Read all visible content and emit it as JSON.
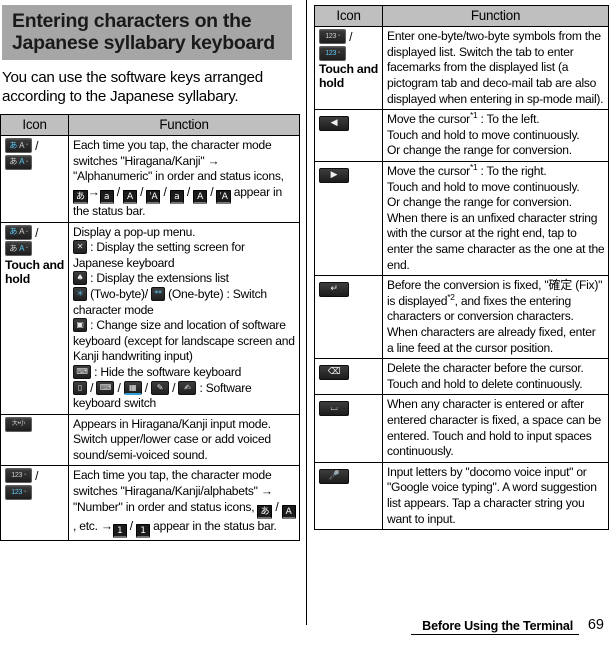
{
  "page": {
    "title": "Entering characters on the Japanese syllabary keyboard",
    "intro": "You can use the software keys arranged according to the Japanese syllabary.",
    "footer_section": "Before Using the Terminal",
    "footer_page_number": "69"
  },
  "table": {
    "headers": {
      "icon": "Icon",
      "function": "Function"
    }
  },
  "left_rows": [
    {
      "icon_name": "kana-alphanumeric-switch-key",
      "icon_glyphs": [
        "あ",
        "A"
      ],
      "separator": "/",
      "touch_and_hold": "",
      "text_1": "Each time you tap, the character mode switches \"Hiragana/Kanji\" → \"Alphanumeric\" in order and status icons,",
      "status_icons": [
        "あ",
        "a",
        "A",
        "A",
        "a",
        "A",
        "A"
      ],
      "arrow": "→",
      "text_2": "appear in the status bar."
    },
    {
      "icon_name": "kana-alphanumeric-switch-key-hold",
      "icon_glyphs": [
        "あ",
        "A"
      ],
      "separator": "/",
      "touch_and_hold": "Touch and hold",
      "line_intro": "Display a pop-up menu.",
      "items": [
        {
          "icon": "settings-wrench-icon",
          "text": ": Display the setting screen for Japanese keyboard"
        },
        {
          "icon": "extensions-icon",
          "text": ": Display the extensions list"
        },
        {
          "icon": "two-byte-icon",
          "text": "(Two-byte)/",
          "icon2": "one-byte-icon",
          "text2": "(One-byte) : Switch character mode"
        },
        {
          "icon": "keyboard-size-location-icon",
          "text": ": Change size and location of software keyboard (except for landscape screen and Kanji handwriting input)"
        },
        {
          "icon": "hide-keyboard-icon",
          "text": ": Hide the software keyboard"
        },
        {
          "icon": "kb-switch-10key-icon",
          "text": ": Software keyboard switch",
          "icons_row": [
            "kb-switch-10key-icon",
            "kb-switch-qwerty-icon",
            "kb-switch-grid-icon",
            "kb-switch-handwriting-icon",
            "kb-switch-handwriting2-icon"
          ]
        }
      ]
    },
    {
      "icon_name": "case-voiced-sound-key",
      "icon_glyph": "大•小",
      "text": "Appears in Hiragana/Kanji input mode. Switch upper/lower case or add voiced sound/semi-voiced sound."
    },
    {
      "icon_name": "number-mode-switch-key",
      "icon_glyphs": [
        "123",
        "123"
      ],
      "separator": "/",
      "text_1": "Each time you tap, the character mode switches \"Hiragana/Kanji/alphabets\" → \"Number\" in order and status icons,",
      "status_icons_a": [
        "あ",
        "A"
      ],
      "mid_text": ", etc.",
      "arrow": "→",
      "status_icons_b": [
        "1",
        "1"
      ],
      "text_2": "appear in the status bar."
    }
  ],
  "right_rows": [
    {
      "icon_name": "number-mode-switch-key-hold",
      "icon_glyphs": [
        "123",
        "123"
      ],
      "separator": "/",
      "touch_and_hold": "Touch and hold",
      "text": "Enter one-byte/two-byte symbols from the displayed list. Switch the tab to enter facemarks from the displayed list (a pictogram tab and deco-mail tab are also displayed when entering in sp-mode mail)."
    },
    {
      "icon_name": "cursor-left-key",
      "icon_glyph": "◀",
      "text_lines": [
        "Move the cursor*1 : To the left.",
        "Touch and hold to move continuously.",
        "Or change the range for conversion."
      ],
      "footnote": "*1"
    },
    {
      "icon_name": "cursor-right-key",
      "icon_glyph": "▶",
      "text_lines": [
        "Move the cursor*1 : To the right.",
        "Touch and hold to move continuously.",
        "Or change the range for conversion.",
        "When there is an unfixed character string with the cursor at the right end, tap to enter the same character as the one at the end."
      ],
      "footnote": "*1"
    },
    {
      "icon_name": "enter-fix-key",
      "icon_glyph": "↵",
      "text": "Before the conversion is fixed, \"確定 (Fix)\" is displayed*2, and fixes the entering characters or conversion characters. When characters are already fixed, enter a line feed at the cursor position.",
      "footnote": "*2"
    },
    {
      "icon_name": "backspace-delete-key",
      "icon_glyph": "⌫",
      "text": "Delete the character before the cursor. Touch and hold to delete continuously."
    },
    {
      "icon_name": "space-key",
      "icon_glyph": "␣",
      "text": "When any character is entered or after entered character is fixed, a space can be entered. Touch and hold to input spaces continuously."
    },
    {
      "icon_name": "voice-input-mic-key",
      "icon_glyph": "🎤",
      "text": "Input letters by \"docomo voice input\" or \"Google voice typing\". A word suggestion list appears. Tap a character string you want to input."
    }
  ],
  "colors": {
    "banner_bg": "#a6a6a6",
    "header_bg": "#bfbfbf",
    "border": "#000000",
    "key_dark": "#2b2b2b",
    "key_highlight": "#5cc8f5"
  }
}
